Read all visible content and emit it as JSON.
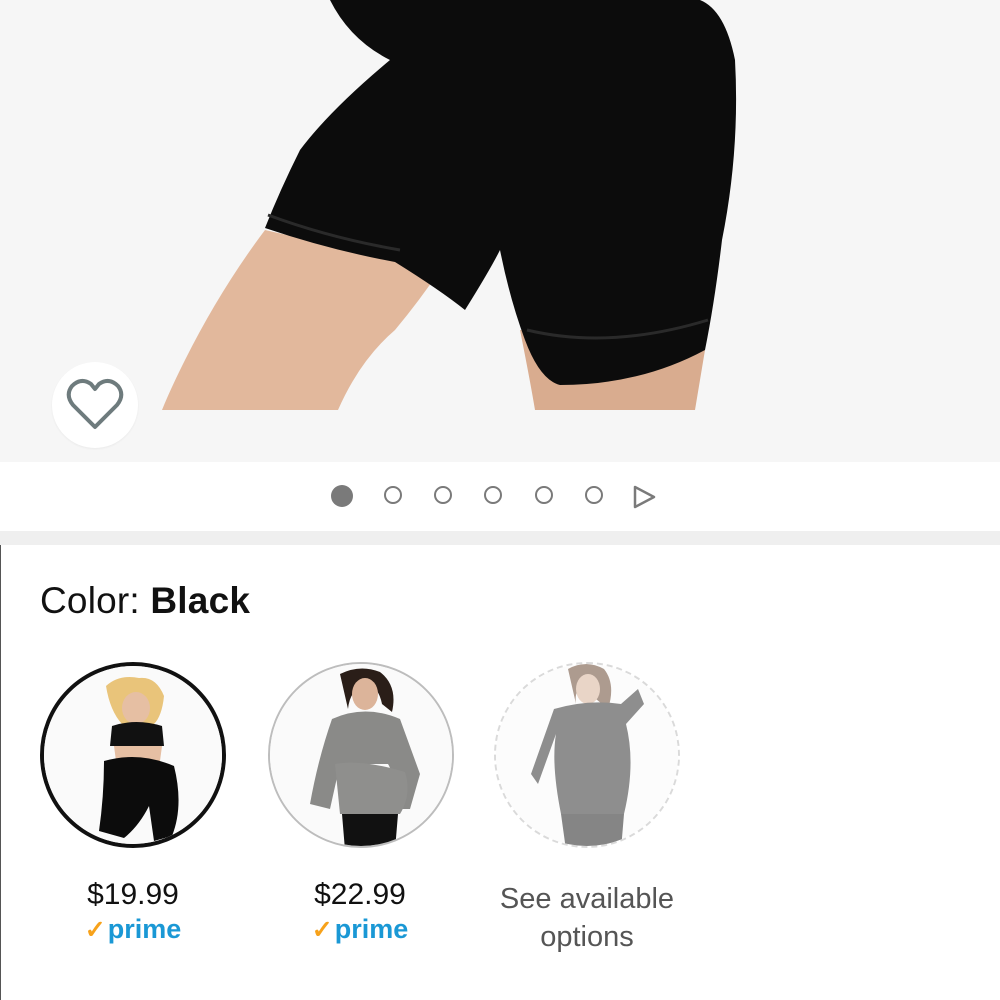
{
  "product": {
    "image_alt": "Black maternity bike shorts",
    "carousel_count": 6,
    "carousel_active": 1
  },
  "color": {
    "label": "Color:",
    "value": "Black"
  },
  "swatches": [
    {
      "price": "$19.99",
      "prime": "prime",
      "selected": true
    },
    {
      "price": "$22.99",
      "prime": "prime",
      "selected": false
    },
    {
      "options_text": "See available options",
      "available": false
    }
  ],
  "colors": {
    "prime_blue": "#1a98d5",
    "prime_check": "#f7a21b",
    "icon_gray": "#7a7a7a"
  }
}
